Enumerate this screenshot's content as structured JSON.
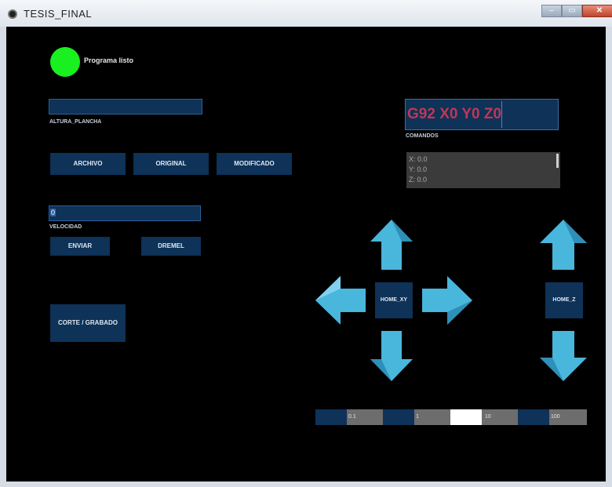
{
  "window": {
    "title": "TESIS_FINAL"
  },
  "status": {
    "text": "Programa listo",
    "color": "#19f01f"
  },
  "altura": {
    "value": "",
    "label": "ALTURA_PLANCHA"
  },
  "file_buttons": {
    "archivo": "ARCHIVO",
    "original": "ORIGINAL",
    "modificado": "MODIFICADO"
  },
  "velocidad": {
    "value": "0",
    "label": "VELOCIDAD"
  },
  "actions": {
    "enviar": "ENVIAR",
    "dremel": "DREMEL",
    "corte": "CORTE / GRABADO"
  },
  "gcode": {
    "command": "G92 X0 Y0 Z0",
    "label": "COMANDOS",
    "color": "#c43555"
  },
  "coords": {
    "x": "X: 0.0",
    "y": "Y: 0.0",
    "z": "Z: 0.0"
  },
  "jog": {
    "home_xy": "HOME_XY",
    "home_z": "HOME_Z",
    "icons": [
      "arrow-up-icon",
      "arrow-down-icon",
      "arrow-left-icon",
      "arrow-right-icon",
      "z-arrow-up-icon",
      "z-arrow-down-icon"
    ]
  },
  "step_sliders": [
    {
      "value": "0.1",
      "fill": 0.5
    },
    {
      "value": "1",
      "fill": 0.5
    },
    {
      "value": "10",
      "fill": 0.5,
      "highlight": true
    },
    {
      "value": "100",
      "fill": 0.5
    }
  ],
  "colors": {
    "panel": "#0e3258",
    "arrow": "#49b6dc",
    "background": "#000000"
  }
}
